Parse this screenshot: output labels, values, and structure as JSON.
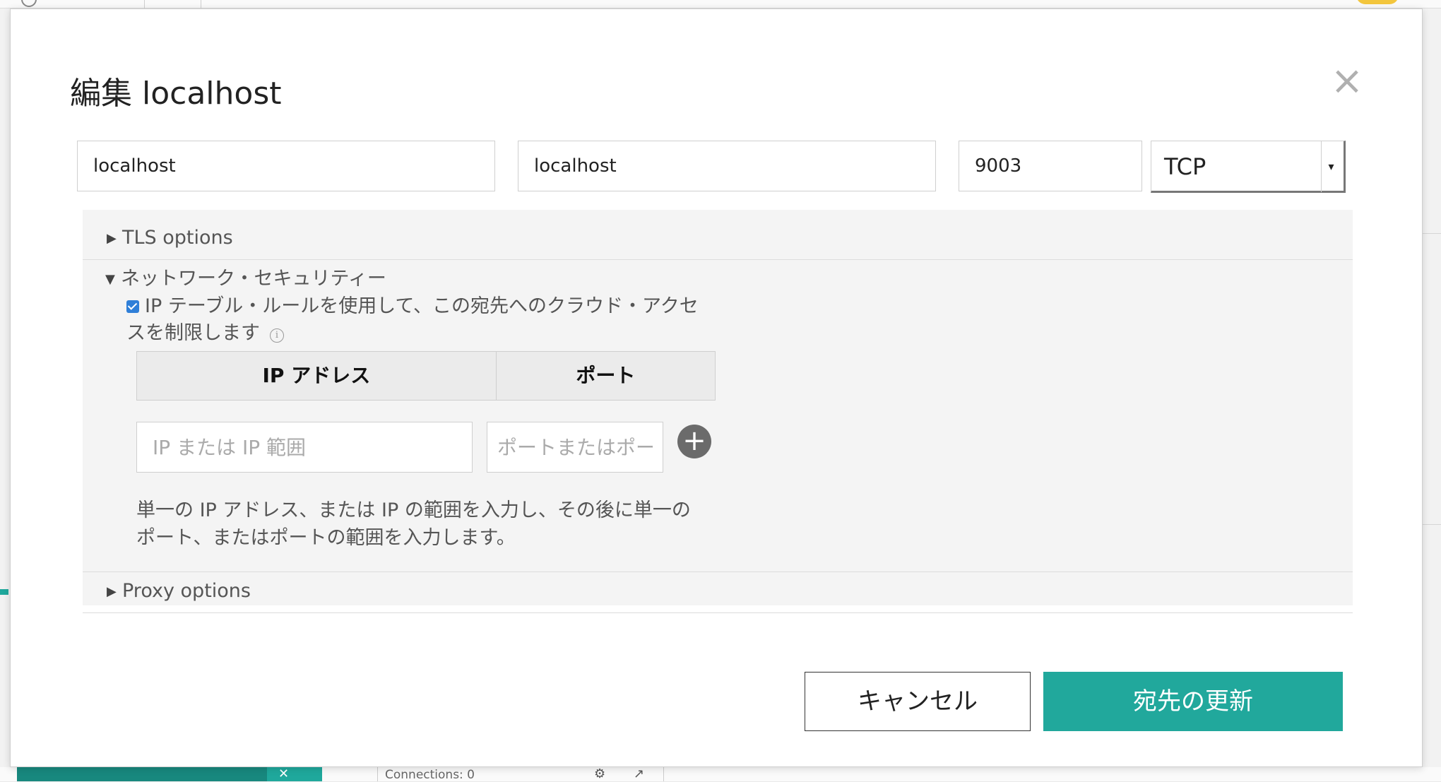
{
  "background": {
    "connections_label": "Connections: 0"
  },
  "modal": {
    "title": "編集 localhost",
    "close_glyph": "×",
    "fields": {
      "name_value": "localhost",
      "host_value": "localhost",
      "port_value": "9003",
      "protocol_value": "TCP",
      "protocol_arrow": "▾"
    },
    "sections": {
      "tls": {
        "label": "TLS options",
        "expanded": false,
        "glyph": "▶"
      },
      "network_security": {
        "label": "ネットワーク・セキュリティー",
        "expanded": true,
        "glyph": "▼",
        "checkbox_checked": true,
        "checkbox_text_line1": "IP テーブル・ルールを使用して、この宛先へのクラウド・アクセ",
        "checkbox_text_line2": "スを制限します",
        "info_glyph": "i",
        "table_headers": {
          "ip": "IP アドレス",
          "port": "ポート"
        },
        "ip_placeholder": "IP または IP 範囲",
        "port_placeholder": "ポートまたはポー",
        "add_glyph": "+",
        "help_line1": "単一の IP アドレス、または IP の範囲を入力し、その後に単一の",
        "help_line2": "ポート、またはポートの範囲を入力します。"
      },
      "proxy": {
        "label": "Proxy options",
        "expanded": false,
        "glyph": "▶"
      }
    },
    "buttons": {
      "cancel": "キャンセル",
      "update": "宛先の更新"
    },
    "colors": {
      "accent": "#21a89c",
      "checkbox": "#2f7fd8"
    }
  }
}
